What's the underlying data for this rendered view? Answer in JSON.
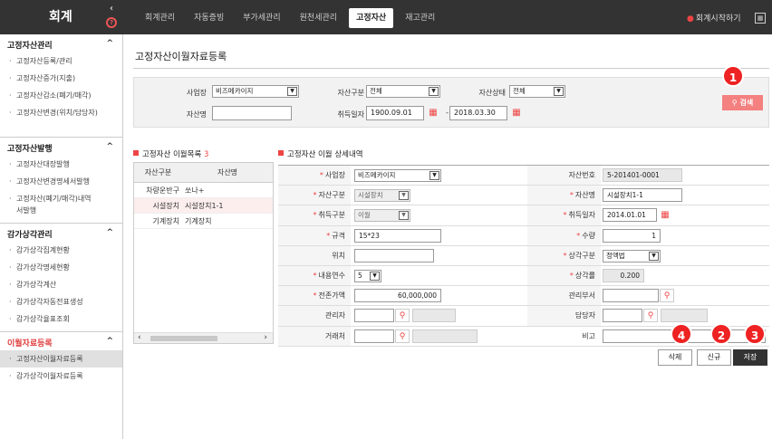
{
  "topbar": {
    "logo": "회계",
    "collapse_icon": "‹",
    "help_icon": "?",
    "tabs": [
      "회계관리",
      "자동증빙",
      "부가세관리",
      "원천세관리",
      "고정자산",
      "재고관리"
    ],
    "active_tab": "고정자산",
    "start_label": "회계시작하기"
  },
  "sidebar": {
    "sections": [
      {
        "title": "고정자산관리",
        "items": [
          "고정자산등록/관리",
          "고정자산증가(지출)",
          "고정자산감소(폐기/매각)",
          "고정자산변경(위치/담당자)"
        ]
      },
      {
        "title": "고정자산발행",
        "items": [
          "고정자산대장발행",
          "고정자산변경명세서발행",
          "고정자산(폐기/매각)내역서발행"
        ]
      },
      {
        "title": "감가상각관리",
        "items": [
          "감가상각집계현황",
          "감가상각명세현황",
          "감가상각계산",
          "감가상각자동전표생성",
          "감가상각율표조회"
        ]
      },
      {
        "title": "이월자료등록",
        "items": [
          "고정자산이월자료등록",
          "감가상각이월자료등록"
        ]
      }
    ],
    "active_section": "이월자료등록",
    "active_item": "고정자산이월자료등록"
  },
  "page_title": "고정자산이월자료등록",
  "filter": {
    "site_label": "사업장",
    "site_value": "비즈메카이지",
    "asset_type_label": "자산구분",
    "asset_type_value": "전체",
    "asset_status_label": "자산상태",
    "asset_status_value": "전체",
    "asset_name_label": "자산명",
    "asset_name_value": "",
    "acq_date_label": "취득일자",
    "date_from": "1900.09.01",
    "date_sep": "-",
    "date_to": "2018.03.30",
    "search_label": "검색"
  },
  "badges": {
    "b1": "1",
    "b2": "2",
    "b3": "3",
    "b4": "4"
  },
  "list": {
    "title": "고정자산 이월목록",
    "count": "3",
    "headers": [
      "자산구분",
      "자산명"
    ],
    "rows": [
      [
        "차량운반구",
        "쏘나+"
      ],
      [
        "시설장치",
        "시설장치1-1"
      ],
      [
        "기계장치",
        "기계장치"
      ]
    ]
  },
  "detail": {
    "title": "고정자산 이월 상세내역",
    "site_label": "사업장",
    "site_value": "비즈메카이지",
    "asset_no_label": "자산번호",
    "asset_no_value": "5-201401-0001",
    "asset_type_label": "자산구분",
    "asset_type_value": "시설장치",
    "asset_name_label": "자산명",
    "asset_name_value": "시설장치1-1",
    "acq_type_label": "취득구분",
    "acq_type_value": "이월",
    "acq_date_label": "취득일자",
    "acq_date_value": "2014.01.01",
    "spec_label": "규격",
    "spec_value": "15*23",
    "qty_label": "수량",
    "qty_value": "1",
    "location_label": "위치",
    "location_value": "",
    "dep_method_label": "상각구분",
    "dep_method_value": "정액법",
    "life_label": "내용연수",
    "life_value": "5",
    "dep_rate_label": "상각률",
    "dep_rate_value": "0.200",
    "prev_amount_label": "전존가액",
    "prev_amount_value": "60,000,000",
    "dept_label": "관리부서",
    "dept_value": "",
    "manager_label": "관리자",
    "manager_value": "",
    "owner_label": "담당자",
    "owner_value": "",
    "vendor_label": "거래처",
    "vendor_value": "",
    "note_label": "비고",
    "note_value": ""
  },
  "actions": {
    "delete_label": "삭제",
    "new_label": "신규",
    "save_label": "저장"
  },
  "colors": {
    "accent_red": "#e44444",
    "topbar": "#333333",
    "search_button": "#f48080"
  }
}
